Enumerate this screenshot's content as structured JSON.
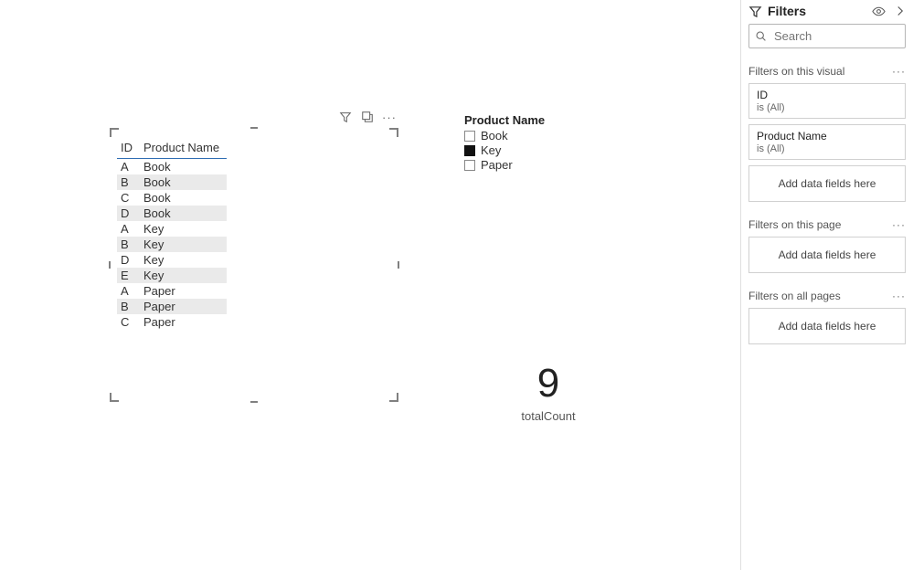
{
  "table": {
    "header_id": "ID",
    "header_product": "Product Name",
    "rows": [
      {
        "id": "A",
        "name": "Book"
      },
      {
        "id": "B",
        "name": "Book"
      },
      {
        "id": "C",
        "name": "Book"
      },
      {
        "id": "D",
        "name": "Book"
      },
      {
        "id": "A",
        "name": "Key"
      },
      {
        "id": "B",
        "name": "Key"
      },
      {
        "id": "D",
        "name": "Key"
      },
      {
        "id": "E",
        "name": "Key"
      },
      {
        "id": "A",
        "name": "Paper"
      },
      {
        "id": "B",
        "name": "Paper"
      },
      {
        "id": "C",
        "name": "Paper"
      }
    ]
  },
  "slicer": {
    "title": "Product Name",
    "items": [
      {
        "label": "Book",
        "selected": false
      },
      {
        "label": "Key",
        "selected": true
      },
      {
        "label": "Paper",
        "selected": false
      }
    ]
  },
  "card": {
    "value": "9",
    "label": "totalCount"
  },
  "filters_pane": {
    "title": "Filters",
    "search_placeholder": "Search",
    "section_visual": "Filters on this visual",
    "section_page": "Filters on this page",
    "section_all": "Filters on all pages",
    "add_fields": "Add data fields here",
    "visual_filters": [
      {
        "name": "ID",
        "condition": "is (All)"
      },
      {
        "name": "Product Name",
        "condition": "is (All)"
      }
    ]
  }
}
